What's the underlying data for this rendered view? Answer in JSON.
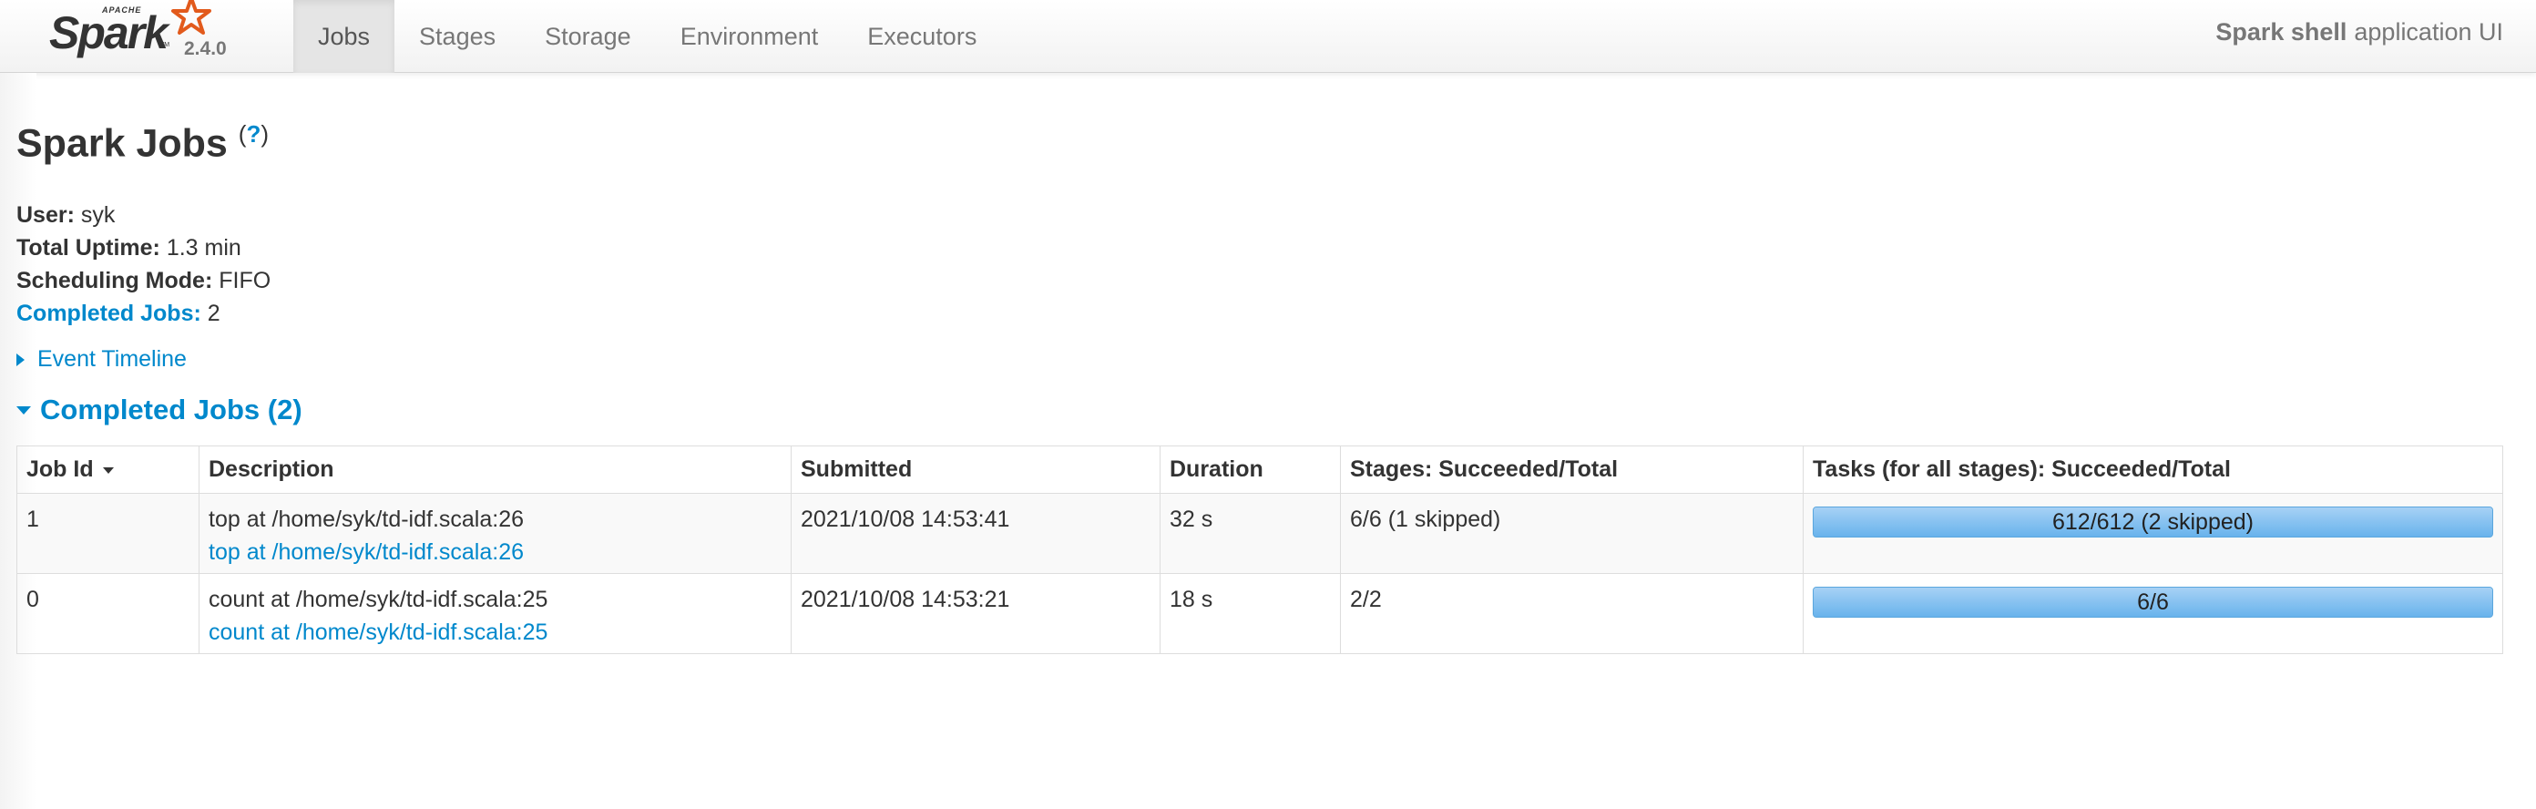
{
  "brand": {
    "apache": "APACHE",
    "name": "Spark",
    "tm": "TM",
    "version": "2.4.0"
  },
  "nav": {
    "tabs": [
      {
        "label": "Jobs",
        "active": true
      },
      {
        "label": "Stages",
        "active": false
      },
      {
        "label": "Storage",
        "active": false
      },
      {
        "label": "Environment",
        "active": false
      },
      {
        "label": "Executors",
        "active": false
      }
    ],
    "app_name": "Spark shell",
    "app_suffix": "application UI"
  },
  "page": {
    "title": "Spark Jobs",
    "help_open": "(",
    "help_link": "?",
    "help_close": ")"
  },
  "summary": {
    "user_label": "User:",
    "user_value": "syk",
    "uptime_label": "Total Uptime:",
    "uptime_value": "1.3 min",
    "scheduling_label": "Scheduling Mode:",
    "scheduling_value": "FIFO",
    "completed_label": "Completed Jobs:",
    "completed_value": "2"
  },
  "event_timeline": {
    "label": "Event Timeline"
  },
  "completed_section": {
    "title": "Completed Jobs (2)"
  },
  "table": {
    "headers": {
      "job_id": "Job Id",
      "description": "Description",
      "submitted": "Submitted",
      "duration": "Duration",
      "stages": "Stages: Succeeded/Total",
      "tasks": "Tasks (for all stages): Succeeded/Total"
    },
    "rows": [
      {
        "job_id": "1",
        "description": "top at /home/syk/td-idf.scala:26",
        "description_link": "top at /home/syk/td-idf.scala:26",
        "submitted": "2021/10/08 14:53:41",
        "duration": "32 s",
        "stages": "6/6 (1 skipped)",
        "tasks": "612/612 (2 skipped)",
        "tasks_fraction": 1.0
      },
      {
        "job_id": "0",
        "description": "count at /home/syk/td-idf.scala:25",
        "description_link": "count at /home/syk/td-idf.scala:25",
        "submitted": "2021/10/08 14:53:21",
        "duration": "18 s",
        "stages": "2/2",
        "tasks": "6/6",
        "tasks_fraction": 1.0
      }
    ]
  },
  "colors": {
    "link": "#0088cc",
    "progress": "#6bb6ee",
    "brand_star": "#e25a1c"
  }
}
